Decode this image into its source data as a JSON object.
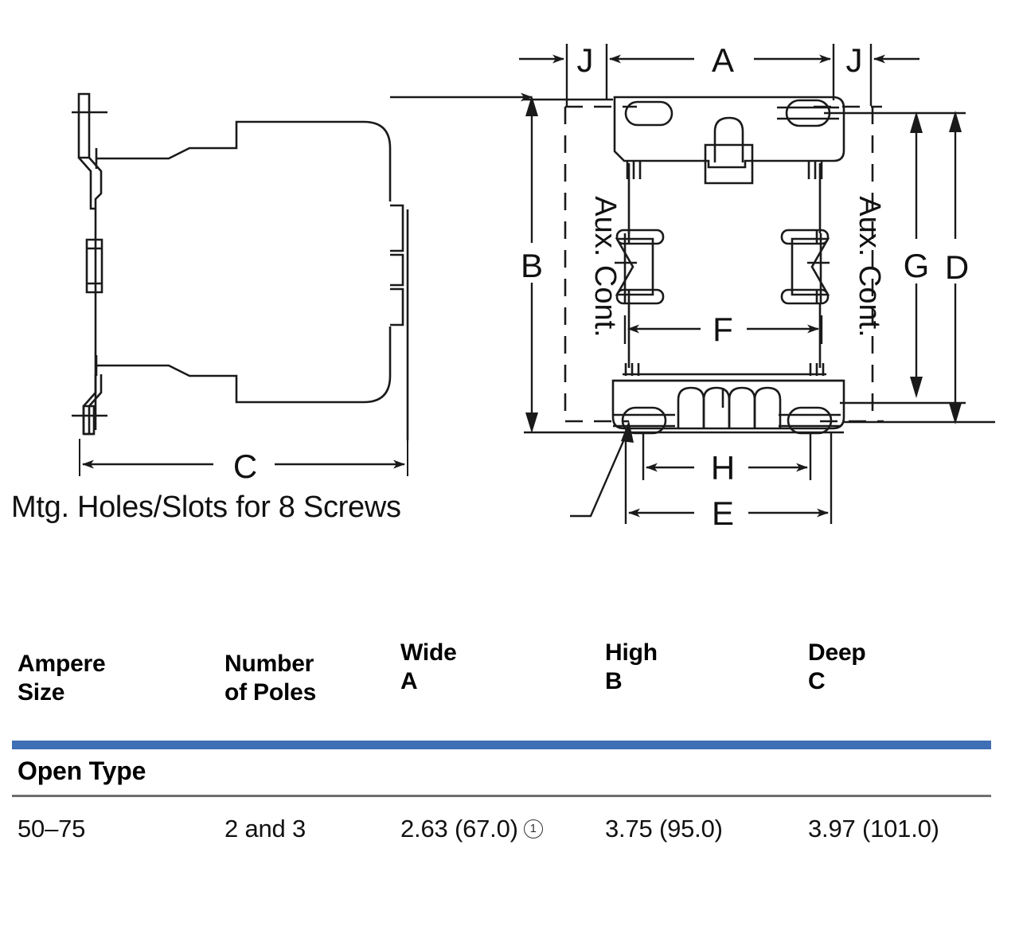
{
  "drawing": {
    "caption": "Mtg. Holes/Slots for 8 Screws",
    "dimension_labels": {
      "A": "A",
      "B": "B",
      "C": "C",
      "D": "D",
      "E": "E",
      "F": "F",
      "G": "G",
      "H": "H",
      "J_left": "J",
      "J_right": "J"
    },
    "annotations": {
      "aux_cont_left": "Aux. Cont.",
      "aux_cont_right": "Aux. Cont."
    },
    "views": {
      "left": "side-view-profile",
      "right": "front-view-mounting-footprint"
    },
    "line_color": "#1a1a1a"
  },
  "table": {
    "headers": [
      {
        "line1": "Ampere",
        "line2": "Size"
      },
      {
        "line1": "Number",
        "line2": "of Poles"
      },
      {
        "line1": "Wide",
        "line2": "A"
      },
      {
        "line1": "High",
        "line2": "B"
      },
      {
        "line1": "Deep",
        "line2": "C"
      }
    ],
    "group_label": "Open Type",
    "accent_color": "#3f6fb5",
    "rows": [
      {
        "ampere_size": "50–75",
        "number_of_poles": "2 and 3",
        "wide_a": "2.63 (67.0)",
        "wide_a_footnote": "1",
        "high_b": "3.75 (95.0)",
        "deep_c": "3.97 (101.0)"
      }
    ]
  }
}
